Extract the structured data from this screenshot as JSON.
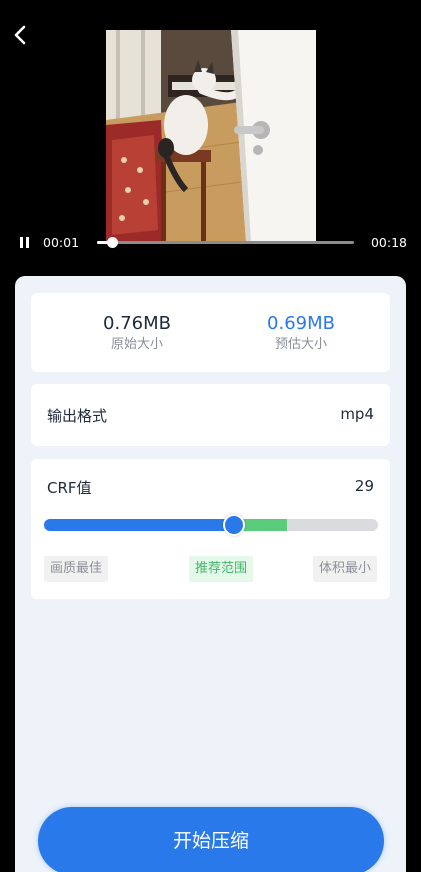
{
  "player": {
    "current_time": "00:01",
    "total_time": "00:18",
    "progress": 0.06
  },
  "sizes": {
    "original_value": "0.76MB",
    "original_label": "原始大小",
    "estimated_value": "0.69MB",
    "estimated_label": "预估大小"
  },
  "format": {
    "label": "输出格式",
    "value": "mp4"
  },
  "crf": {
    "label": "CRF值",
    "value": "29",
    "min": 0,
    "max": 51,
    "recommended_range": [
      18,
      28
    ],
    "tags": {
      "best_quality": "画质最佳",
      "recommended": "推荐范围",
      "smallest_size": "体积最小"
    }
  },
  "actions": {
    "start_label": "开始压缩"
  },
  "colors": {
    "accent": "#2a79ea",
    "recommended": "#5ccb7b",
    "track": "#d9dbde"
  }
}
